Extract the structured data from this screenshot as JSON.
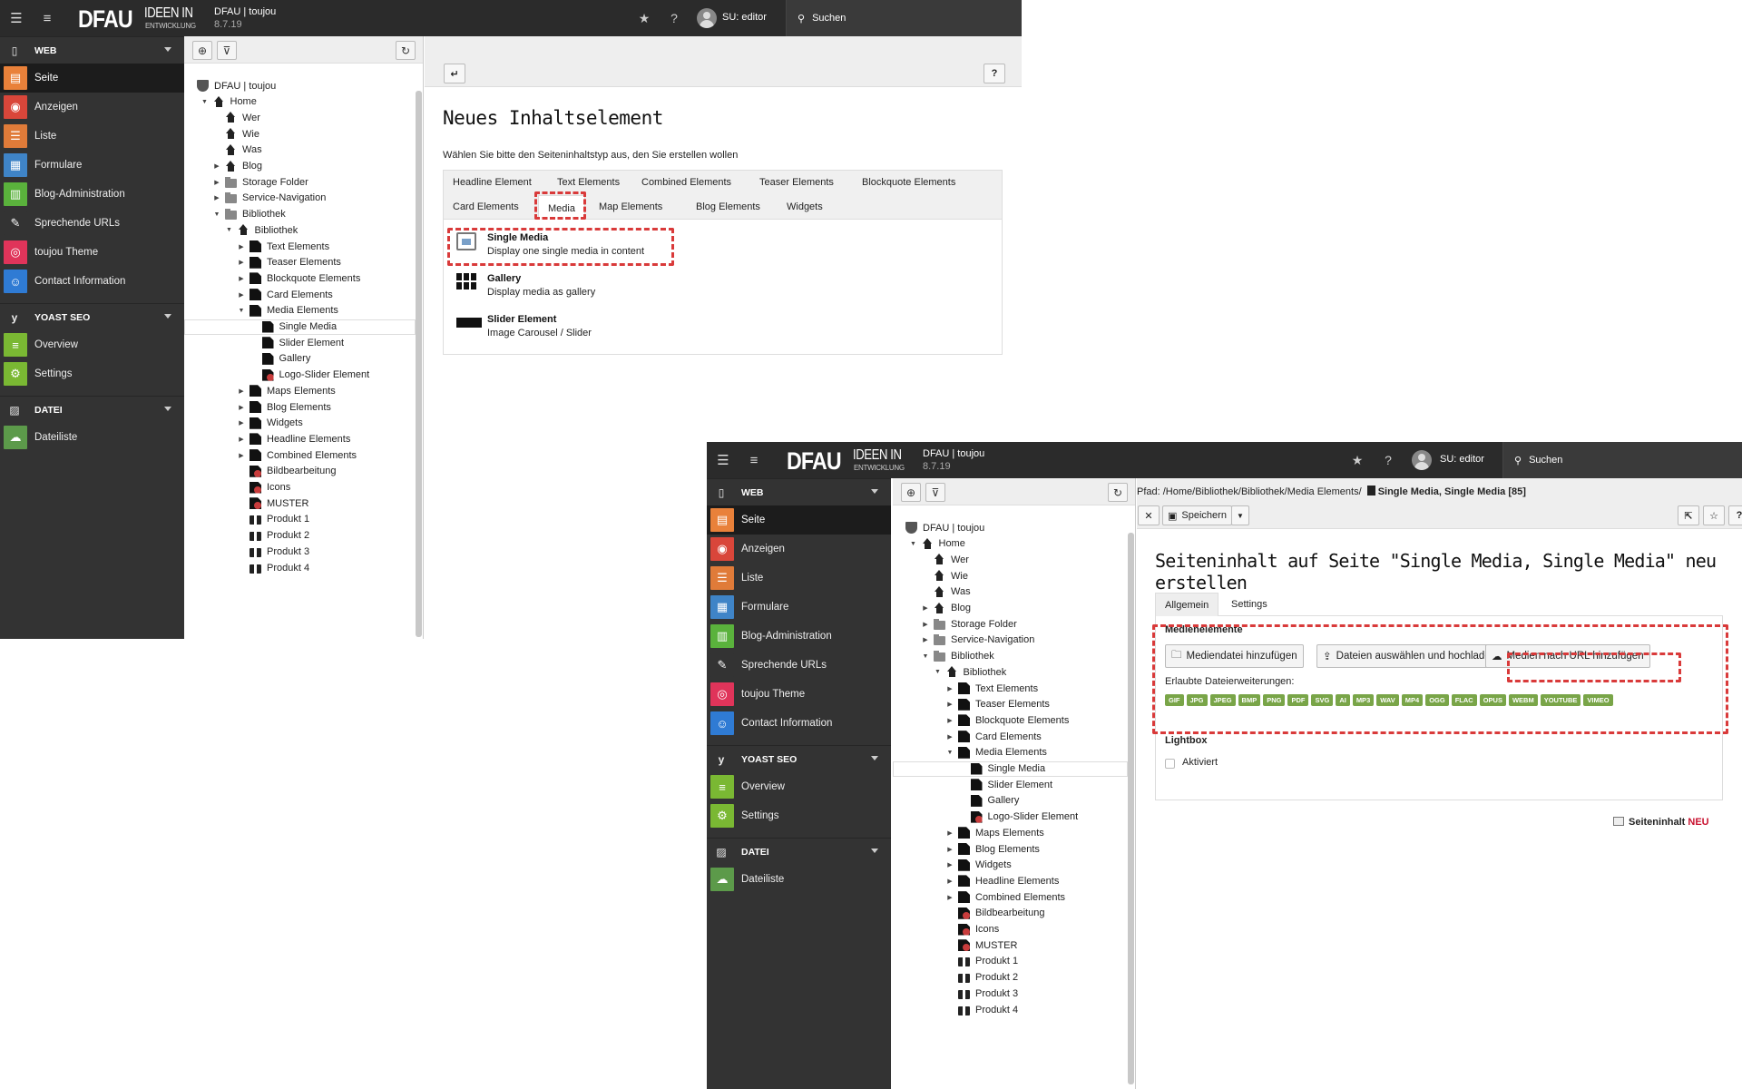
{
  "app": {
    "logo_main": "DFAU",
    "logo_sub1": "IDEEN IN",
    "logo_sub2": "ENTWICKLUNG",
    "site_name": "DFAU | toujou",
    "version": "8.7.19",
    "user": "SU: editor",
    "search_label": "Suchen"
  },
  "module_menu": {
    "groups": [
      {
        "label": "WEB",
        "icon": "file-icon",
        "items": [
          {
            "label": "Seite",
            "icon": "page-module-icon",
            "color": "#e9813a",
            "active": true
          },
          {
            "label": "Anzeigen",
            "icon": "eye-icon",
            "color": "#d9463a"
          },
          {
            "label": "Liste",
            "icon": "list-module-icon",
            "color": "#e07b39"
          },
          {
            "label": "Formulare",
            "icon": "form-icon",
            "color": "#3f84c7"
          },
          {
            "label": "Blog-Administration",
            "icon": "blog-admin-icon",
            "color": "#5ab23c"
          },
          {
            "label": "Sprechende URLs",
            "icon": "pen-icon",
            "color": "#333333"
          },
          {
            "label": "toujou Theme",
            "icon": "fingerprint-icon",
            "color": "#e0345a"
          },
          {
            "label": "Contact Information",
            "icon": "contact-icon",
            "color": "#2f7bd4"
          }
        ]
      },
      {
        "label": "YOAST SEO",
        "icon": "yoast-icon",
        "items": [
          {
            "label": "Overview",
            "icon": "overview-icon",
            "color": "#7ab833"
          },
          {
            "label": "Settings",
            "icon": "settings-gear-icon",
            "color": "#7ab833"
          }
        ]
      },
      {
        "label": "DATEI",
        "icon": "image-icon",
        "items": [
          {
            "label": "Dateiliste",
            "icon": "cloud-icon",
            "color": "#5c9a4a"
          }
        ]
      }
    ]
  },
  "page_tree": {
    "root": "DFAU | toujou",
    "nodes": [
      {
        "label": "Home",
        "icon": "home",
        "level": 1,
        "exp": "▼"
      },
      {
        "label": "Wer",
        "icon": "home",
        "level": 2,
        "exp": ""
      },
      {
        "label": "Wie",
        "icon": "home",
        "level": 2,
        "exp": ""
      },
      {
        "label": "Was",
        "icon": "home",
        "level": 2,
        "exp": ""
      },
      {
        "label": "Blog",
        "icon": "home",
        "level": 2,
        "exp": "▶"
      },
      {
        "label": "Storage Folder",
        "icon": "folder",
        "level": 2,
        "exp": "▶"
      },
      {
        "label": "Service-Navigation",
        "icon": "folder",
        "level": 2,
        "exp": "▶"
      },
      {
        "label": "Bibliothek",
        "icon": "folder",
        "level": 2,
        "exp": "▼"
      },
      {
        "label": "Bibliothek",
        "icon": "home",
        "level": 3,
        "exp": "▼"
      },
      {
        "label": "Text Elements",
        "icon": "page",
        "level": 4,
        "exp": "▶"
      },
      {
        "label": "Teaser Elements",
        "icon": "page",
        "level": 4,
        "exp": "▶"
      },
      {
        "label": "Blockquote Elements",
        "icon": "page",
        "level": 4,
        "exp": "▶"
      },
      {
        "label": "Card Elements",
        "icon": "page",
        "level": 4,
        "exp": "▶"
      },
      {
        "label": "Media Elements",
        "icon": "page",
        "level": 4,
        "exp": "▼"
      },
      {
        "label": "Single Media",
        "icon": "page",
        "level": 5,
        "exp": "",
        "selected": true
      },
      {
        "label": "Slider Element",
        "icon": "page",
        "level": 5,
        "exp": ""
      },
      {
        "label": "Gallery",
        "icon": "page",
        "level": 5,
        "exp": ""
      },
      {
        "label": "Logo-Slider Element",
        "icon": "red",
        "level": 5,
        "exp": ""
      },
      {
        "label": "Maps Elements",
        "icon": "page",
        "level": 4,
        "exp": "▶"
      },
      {
        "label": "Blog Elements",
        "icon": "page",
        "level": 4,
        "exp": "▶"
      },
      {
        "label": "Widgets",
        "icon": "page",
        "level": 4,
        "exp": "▶"
      },
      {
        "label": "Headline Elements",
        "icon": "page",
        "level": 4,
        "exp": "▶"
      },
      {
        "label": "Combined Elements",
        "icon": "page",
        "level": 4,
        "exp": "▶"
      },
      {
        "label": "Bildbearbeitung",
        "icon": "red",
        "level": 4,
        "exp": ""
      },
      {
        "label": "Icons",
        "icon": "red",
        "level": 4,
        "exp": ""
      },
      {
        "label": "MUSTER",
        "icon": "red",
        "level": 4,
        "exp": ""
      },
      {
        "label": "Produkt 1",
        "icon": "gift",
        "level": 4,
        "exp": ""
      },
      {
        "label": "Produkt 2",
        "icon": "gift",
        "level": 4,
        "exp": ""
      },
      {
        "label": "Produkt 3",
        "icon": "gift",
        "level": 4,
        "exp": ""
      },
      {
        "label": "Produkt 4",
        "icon": "gift",
        "level": 4,
        "exp": ""
      }
    ]
  },
  "wizard": {
    "title": "Neues Inhaltselement",
    "instruction": "Wählen Sie bitte den Seiteninhaltstyp aus, den Sie erstellen wollen",
    "tabs_row1": [
      "Headline Element",
      "Text Elements",
      "Combined Elements",
      "Teaser Elements",
      "Blockquote Elements"
    ],
    "tabs_row2": [
      "Card Elements",
      "Media",
      "Map Elements",
      "Blog Elements",
      "Widgets"
    ],
    "active_tab": "Media",
    "elements": [
      {
        "title": "Single Media",
        "desc": "Display one single media in content",
        "icon": "single-media-icon"
      },
      {
        "title": "Gallery",
        "desc": "Display media as gallery",
        "icon": "gallery-grid-icon"
      },
      {
        "title": "Slider Element",
        "desc": "Image Carousel / Slider",
        "icon": "slider-icon"
      }
    ]
  },
  "editor": {
    "path_label": "Pfad: /Home/Bibliothek/Bibliothek/Media Elements/",
    "path_page": "Single Media, Single Media [85]",
    "save_label": "Speichern",
    "title": "Seiteninhalt auf Seite \"Single Media, Single Media\" neu erstellen",
    "tabs": [
      "Allgemein",
      "Settings"
    ],
    "media_section": "Medienelemente",
    "btn_add_media": "Mediendatei hinzufügen",
    "btn_upload": "Dateien auswählen und hochladen",
    "btn_url": "Medien nach URL hinzufügen",
    "allowed_label": "Erlaubte Dateierweiterungen:",
    "extensions": [
      "GIF",
      "JPG",
      "JPEG",
      "BMP",
      "PNG",
      "PDF",
      "SVG",
      "AI",
      "MP3",
      "WAV",
      "MP4",
      "OGG",
      "FLAC",
      "OPUS",
      "WEBM",
      "YOUTUBE",
      "VIMEO"
    ],
    "lightbox_label": "Lightbox",
    "lightbox_checkbox": "Aktiviert",
    "footer_label": "Seiteninhalt",
    "footer_new": "NEU"
  }
}
